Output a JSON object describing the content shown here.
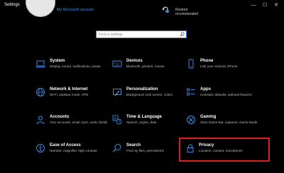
{
  "window": {
    "title": "Settings",
    "controls": {
      "minimize": "—",
      "maximize": "☐",
      "close": "✕"
    }
  },
  "account": {
    "link_text": "My Microsoft account",
    "update_status": "Restore\nrecommended"
  },
  "search": {
    "placeholder": "Find a setting"
  },
  "categories": [
    {
      "title": "System",
      "description": "Display, sound, notifications, power",
      "icon": "laptop-icon"
    },
    {
      "title": "Devices",
      "description": "Bluetooth, printers, mouse",
      "icon": "keyboard-icon"
    },
    {
      "title": "Phone",
      "description": "Link your Android, iPhone",
      "icon": "phone-icon"
    },
    {
      "title": "Network & Internet",
      "description": "Wi-Fi, airplane mode, VPN",
      "icon": "globe-icon"
    },
    {
      "title": "Personalization",
      "description": "Background, lock screen, colors",
      "icon": "paintbrush-icon"
    },
    {
      "title": "Apps",
      "description": "Uninstall, defaults, optional features",
      "icon": "apps-list-icon"
    },
    {
      "title": "Accounts",
      "description": "Your accounts, email, sync, work, family",
      "icon": "person-icon"
    },
    {
      "title": "Time & Language",
      "description": "Speech, region, date",
      "icon": "time-language-icon"
    },
    {
      "title": "Gaming",
      "description": "Xbox Game Bar, captures, Game Mode",
      "icon": "xbox-icon"
    },
    {
      "title": "Ease of Access",
      "description": "Narrator, magnifier, high contrast",
      "icon": "ease-of-access-icon"
    },
    {
      "title": "Search",
      "description": "Find my files, permissions",
      "icon": "search-icon"
    },
    {
      "title": "Privacy",
      "description": "Location, camera, microphone",
      "icon": "lock-icon"
    }
  ],
  "colors": {
    "accent": "#3a8ee6",
    "highlight": "#e21b1b",
    "background": "#000000"
  }
}
